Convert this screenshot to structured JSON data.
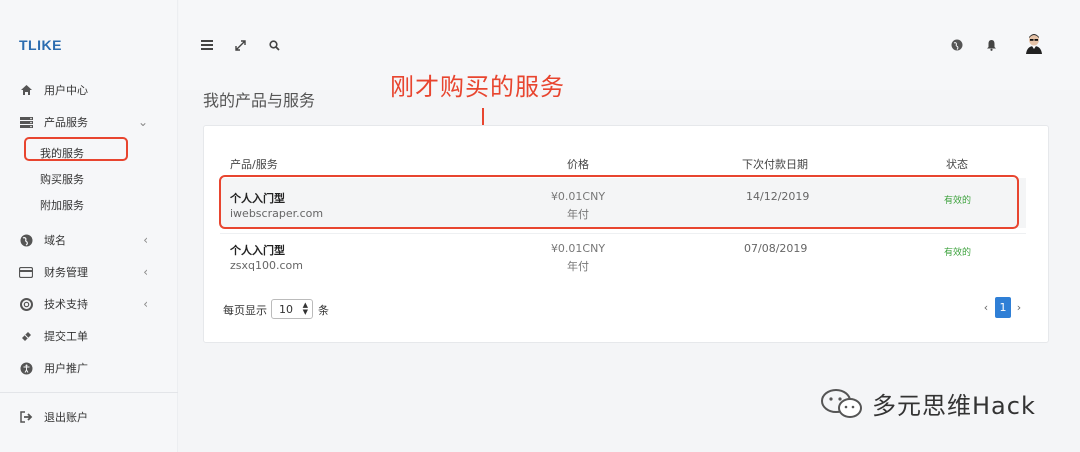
{
  "sidebar": {
    "logo": "TLIKE",
    "items": [
      {
        "label": "用户中心",
        "icon": "home-icon",
        "chevron": ""
      },
      {
        "label": "产品服务",
        "icon": "server-icon",
        "chevron": "⌄"
      },
      {
        "label": "域名",
        "icon": "globe-icon",
        "chevron": "‹"
      },
      {
        "label": "财务管理",
        "icon": "credit-card-icon",
        "chevron": "‹"
      },
      {
        "label": "技术支持",
        "icon": "lifebuoy-icon",
        "chevron": "‹"
      },
      {
        "label": "提交工单",
        "icon": "ticket-icon",
        "chevron": ""
      },
      {
        "label": "用户推广",
        "icon": "universal-access-icon",
        "chevron": ""
      }
    ],
    "sub_items": [
      "我的服务",
      "购买服务",
      "附加服务"
    ],
    "logout": "退出账户"
  },
  "topbar": {
    "icons": [
      "menu-icon",
      "expand-icon",
      "search-icon",
      "globe-icon",
      "bell-icon",
      "avatar"
    ]
  },
  "page": {
    "title": "我的产品与服务",
    "annotation": "刚才购买的服务"
  },
  "table": {
    "headers": [
      "产品/服务",
      "价格",
      "下次付款日期",
      "状态"
    ],
    "rows": [
      {
        "product": "个人入门型",
        "domain": "iwebscraper.com",
        "price": "¥0.01CNY",
        "cycle": "年付",
        "due": "14/12/2019",
        "status": "有效的"
      },
      {
        "product": "个人入门型",
        "domain": "zsxq100.com",
        "price": "¥0.01CNY",
        "cycle": "年付",
        "due": "07/08/2019",
        "status": "有效的"
      }
    ]
  },
  "pagination": {
    "per_page_label": "每页显示",
    "per_page_value": "10",
    "unit": "条",
    "current_page": "1",
    "prev": "‹",
    "next": "›"
  },
  "watermark": "多元思维Hack",
  "colors": {
    "accent": "#2f7fd6",
    "annotation": "#e8452f",
    "status_active": "#3fa33f"
  }
}
